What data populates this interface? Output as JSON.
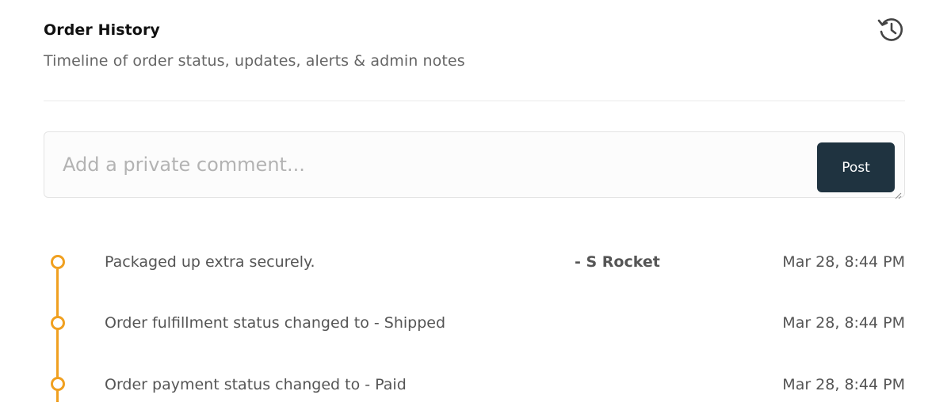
{
  "header": {
    "title": "Order History",
    "subtitle": "Timeline of order status, updates, alerts & admin notes",
    "icon": "history-icon"
  },
  "comment": {
    "placeholder": "Add a private comment...",
    "value": "",
    "post_label": "Post"
  },
  "colors": {
    "timeline_accent": "#f0a020",
    "post_button_bg": "#1f3340"
  },
  "timeline": [
    {
      "text": "Packaged up extra securely.",
      "author": "- S Rocket",
      "time": "Mar 28, 8:44 PM"
    },
    {
      "text": "Order fulfillment status changed to - Shipped",
      "author": "",
      "time": "Mar 28, 8:44 PM"
    },
    {
      "text": "Order payment status changed to - Paid",
      "author": "",
      "time": "Mar 28, 8:44 PM"
    }
  ]
}
